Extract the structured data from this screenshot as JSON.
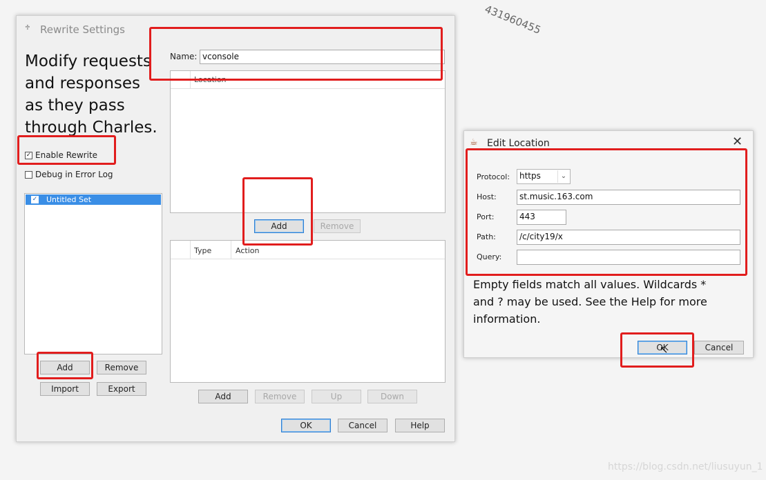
{
  "rewrite_settings": {
    "title": "Rewrite Settings",
    "intro": [
      "Modify requests",
      "and responses",
      "as they pass",
      "through Charles."
    ],
    "enable_rewrite": {
      "label": "Enable Rewrite",
      "checked": true
    },
    "debug_log": {
      "label": "Debug in Error Log",
      "checked": false
    },
    "sets": [
      {
        "label": "Untitled Set",
        "checked": true
      }
    ],
    "set_buttons": {
      "add": "Add",
      "remove": "Remove",
      "import": "Import",
      "export": "Export"
    },
    "name_label": "Name:",
    "name_value": "vconsole",
    "location_header": "Location",
    "location_buttons": {
      "add": "Add",
      "remove": "Remove"
    },
    "rule_headers": {
      "type": "Type",
      "action": "Action"
    },
    "rule_buttons": {
      "add": "Add",
      "remove": "Remove",
      "up": "Up",
      "down": "Down"
    },
    "footer_buttons": {
      "ok": "OK",
      "cancel": "Cancel",
      "help": "Help"
    }
  },
  "edit_location": {
    "title": "Edit Location",
    "protocol_label": "Protocol:",
    "protocol_value": "https",
    "host_label": "Host:",
    "host_value": "st.music.163.com",
    "port_label": "Port:",
    "port_value": "443",
    "path_label": "Path:",
    "path_value": "/c/city19/x",
    "query_label": "Query:",
    "query_value": "",
    "help_text": [
      "Empty fields match all values. Wildcards *",
      "and ? may be used. See the Help for more",
      "information."
    ],
    "ok": "OK",
    "cancel": "Cancel"
  },
  "watermarks": {
    "top": "431960455",
    "bottom": "https://blog.csdn.net/liusuyun_1"
  },
  "colors": {
    "highlight_red": "#e11d1d",
    "selection_blue": "#3a8ee6",
    "dialog_bg": "#f0f0f0"
  }
}
